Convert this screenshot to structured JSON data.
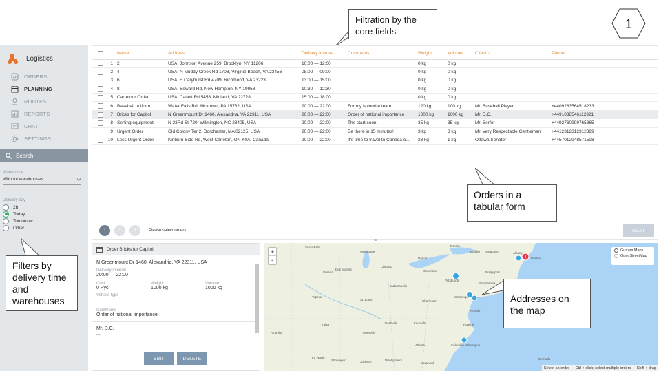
{
  "annotations": {
    "filtration": "Filtration by the core fields",
    "orders_tabular": "Orders in a tabular form",
    "filters": "Filters by delivery time and warehouses",
    "addresses": "Addresses on the map",
    "step": "1"
  },
  "sidebar": {
    "brand": "Logistics",
    "nav": [
      {
        "label": "ORDERS",
        "icon": "orders-icon",
        "active": false
      },
      {
        "label": "PLANNING",
        "icon": "calendar-icon",
        "active": true
      },
      {
        "label": "ROUTES",
        "icon": "routes-icon",
        "active": false
      },
      {
        "label": "REPORTS",
        "icon": "reports-icon",
        "active": false
      },
      {
        "label": "CHAT",
        "icon": "chat-icon",
        "active": false
      },
      {
        "label": "SETTINGS",
        "icon": "gear-icon",
        "active": false
      }
    ],
    "search_label": "Search",
    "warehouse_label": "Warehouse",
    "warehouse_value": "Without warehouses",
    "delivery_day_label": "Delivery day",
    "delivery_options": [
      "2h",
      "Today",
      "Tomorrow",
      "Other"
    ],
    "delivery_selected": "Today"
  },
  "table": {
    "headers": {
      "name": "Name",
      "address": "Address",
      "interval": "Delivery interval",
      "comments": "Comments",
      "weight": "Weight",
      "volume": "Volume",
      "client": "Client ↑",
      "phone": "Phone"
    },
    "rows": [
      {
        "n": "1",
        "name": "2",
        "address": "USA, Johnson Avenue 259, Brooklyn, NY 11206",
        "interval": "10:00 — 12:00",
        "comments": "",
        "weight": "0 kg",
        "volume": "0 kg",
        "client": "",
        "phone": ""
      },
      {
        "n": "2",
        "name": "4",
        "address": "USA, N Muddy Creek Rd 1708, Virginia Beach, VA 23456",
        "interval": "08:00 — 09:00",
        "comments": "",
        "weight": "0 kg",
        "volume": "0 kg",
        "client": "",
        "phone": ""
      },
      {
        "n": "3",
        "name": "6",
        "address": "USA, E Caryhurst Rd 4709, Richmond, VA 23223",
        "interval": "13:00 — 15:00",
        "comments": "",
        "weight": "0 kg",
        "volume": "0 kg",
        "client": "",
        "phone": ""
      },
      {
        "n": "4",
        "name": "8",
        "address": "USA, Seward Rd, New Hampton, NY 10958",
        "interval": "10:30 — 12:30",
        "comments": "",
        "weight": "0 kg",
        "volume": "0 kg",
        "client": "",
        "phone": ""
      },
      {
        "n": "5",
        "name": "Carrefour Order",
        "address": "USA, Catlett Rd 5453, Midland, VA 22728",
        "interval": "15:00 — 18:00",
        "comments": "",
        "weight": "0 kg",
        "volume": "0 kg",
        "client": "",
        "phone": ""
      },
      {
        "n": "6",
        "name": "Baseball uniform",
        "address": "Water Falls Rd, Nicktown, PA 15762, USA",
        "interval": "20:00 — 22:00",
        "comments": "For my favourite team",
        "weight": "120 kg",
        "volume": "100 kg",
        "client": "Mr. Baseball Player",
        "phone": "+4409283564518233"
      },
      {
        "n": "7",
        "name": "Bricks for Capitol",
        "address": "N Greenmount Dr 1460, Alexandria, VA 22311, USA",
        "interval": "20:00 — 22:00",
        "comments": "Order of national importance",
        "weight": "1000 kg",
        "volume": "1000 kg",
        "client": "Mr. D.C.",
        "phone": "+4491038546112321",
        "selected": true
      },
      {
        "n": "8",
        "name": "Serfing equipment",
        "address": "N 23Rd St 720, Wilmington, NC 28405, USA",
        "interval": "20:00 — 22:00",
        "comments": "The start soon!",
        "weight": "35 kg",
        "volume": "35 kg",
        "client": "Mr. Serfer",
        "phone": "+4492760999765865"
      },
      {
        "n": "9",
        "name": "Urgent Order",
        "address": "Old Colony Ter 2, Dorchester, MA 02125, USA",
        "interval": "20:00 — 22:00",
        "comments": "Be there in 15 minutes!",
        "weight": "3 kg",
        "volume": "3 kg",
        "client": "Mr. Very Respectable Gentleman",
        "phone": "+4412312312312399"
      },
      {
        "n": "10",
        "name": "Less Urgent Order",
        "address": "Kinburn Side Rd, West Carleton, ON K0A, Canada",
        "interval": "20:00 — 22:00",
        "comments": "It's time to travel to Canada o...",
        "weight": "23 kg",
        "volume": "1 kg",
        "client": "Ottawa Senator",
        "phone": "+4457012948571598"
      }
    ],
    "pages": [
      "1",
      "2",
      "3"
    ],
    "pager_hint": "Please select orders",
    "next": "NEXT",
    "menu_glyph": "⋮"
  },
  "detail": {
    "title": "Order Bricks for Capitol",
    "address": "N Greenmount Dr 1460, Alexandria, VA 22311, USA",
    "interval_label": "Delivery interval",
    "interval": "20:00 — 22:00",
    "cost_label": "Cost",
    "cost": "0 Pyc",
    "weight_label": "Weight",
    "weight": "1000 kg",
    "volume_label": "Volume",
    "volume": "1000 kg",
    "vehicle_label": "Vehicle type",
    "comments_label": "Comments",
    "comments": "Order of national importance",
    "client": "Mr. D.C.",
    "client_extra": "...",
    "edit": "EDIT",
    "delete": "DELETE"
  },
  "map": {
    "layers": [
      "Gurtam Maps",
      "OpenStreetMap"
    ],
    "layer_selected": "Gurtam Maps",
    "zoom_in": "+",
    "zoom_out": "-",
    "hint": "Select an order — Ctrl + click; select multiple orders — Shift + drag",
    "cluster_count": "3",
    "cities": [
      "Sioux Falls",
      "Milwaukee",
      "Toronto",
      "Buffalo",
      "Syracuse",
      "Albany",
      "Boston",
      "Detroit",
      "Chicago",
      "Cleveland",
      "Omaha",
      "Des Moines",
      "Pittsburgh",
      "Bridgeport",
      "Philadelphia",
      "Indianapolis",
      "Topeka",
      "St. Louis",
      "Charleston",
      "Washington",
      "D.C.",
      "Norfolk",
      "Nashville",
      "Knoxville",
      "Raleigh",
      "Tulsa",
      "Memphis",
      "Amarillo",
      "Atlanta",
      "Columbia",
      "Wilmington",
      "Ft. Worth",
      "Shreveport",
      "Jackson",
      "Montgomery",
      "Savannah",
      "Bermuda"
    ],
    "colors": {
      "water": "#aad3f5",
      "land": "#eef0e2",
      "marker": "#3aa5de",
      "cluster": "#e8334a"
    }
  }
}
